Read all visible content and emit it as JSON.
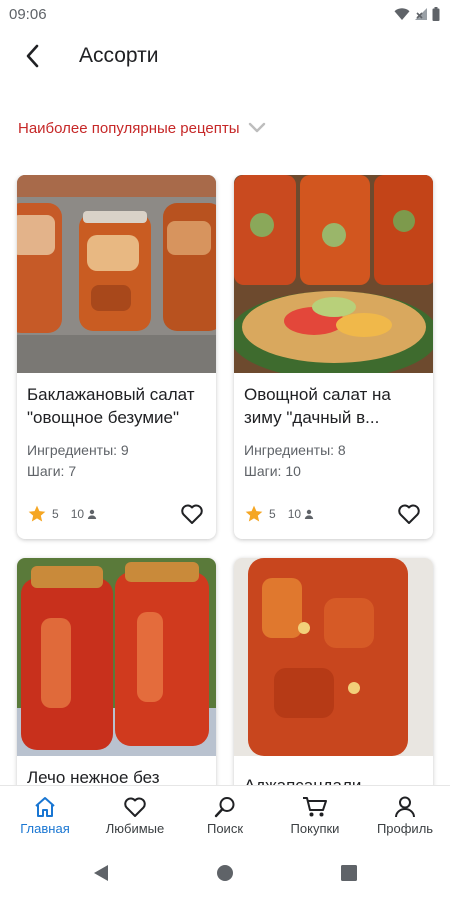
{
  "status_bar": {
    "time": "09:06",
    "icons": [
      "wifi-icon",
      "no-signal-icon",
      "battery-icon"
    ]
  },
  "header": {
    "title": "Ассорти",
    "back_icon": "arrow-back-icon"
  },
  "filter": {
    "label": "Наиболее популярные рецепты",
    "icon": "chevron-down-icon"
  },
  "recipes": [
    {
      "title": "Баклажановый салат \"овощное безумие\"",
      "ingredients": "Ингредиенты: 9",
      "steps": "Шаги: 7",
      "rating": "5",
      "count": "10"
    },
    {
      "title": "Овощной салат на зиму \"дачный в...",
      "ingredients": "Ингредиенты: 8",
      "steps": "Шаги: 10",
      "rating": "5",
      "count": "10"
    },
    {
      "title": "Лечо нежное без",
      "ingredients": "",
      "steps": "",
      "rating": "",
      "count": ""
    },
    {
      "title": "Аджапсандали",
      "ingredients": "",
      "steps": "",
      "rating": "",
      "count": ""
    }
  ],
  "bottom_nav": [
    {
      "label": "Главная",
      "icon": "home-icon",
      "active": true
    },
    {
      "label": "Любимые",
      "icon": "heart-icon",
      "active": false
    },
    {
      "label": "Поиск",
      "icon": "search-icon",
      "active": false
    },
    {
      "label": "Покупки",
      "icon": "cart-icon",
      "active": false
    },
    {
      "label": "Профиль",
      "icon": "profile-icon",
      "active": false
    }
  ],
  "colors": {
    "accent": "#c62828",
    "active_nav": "#1976d2",
    "star": "#f5a623"
  }
}
